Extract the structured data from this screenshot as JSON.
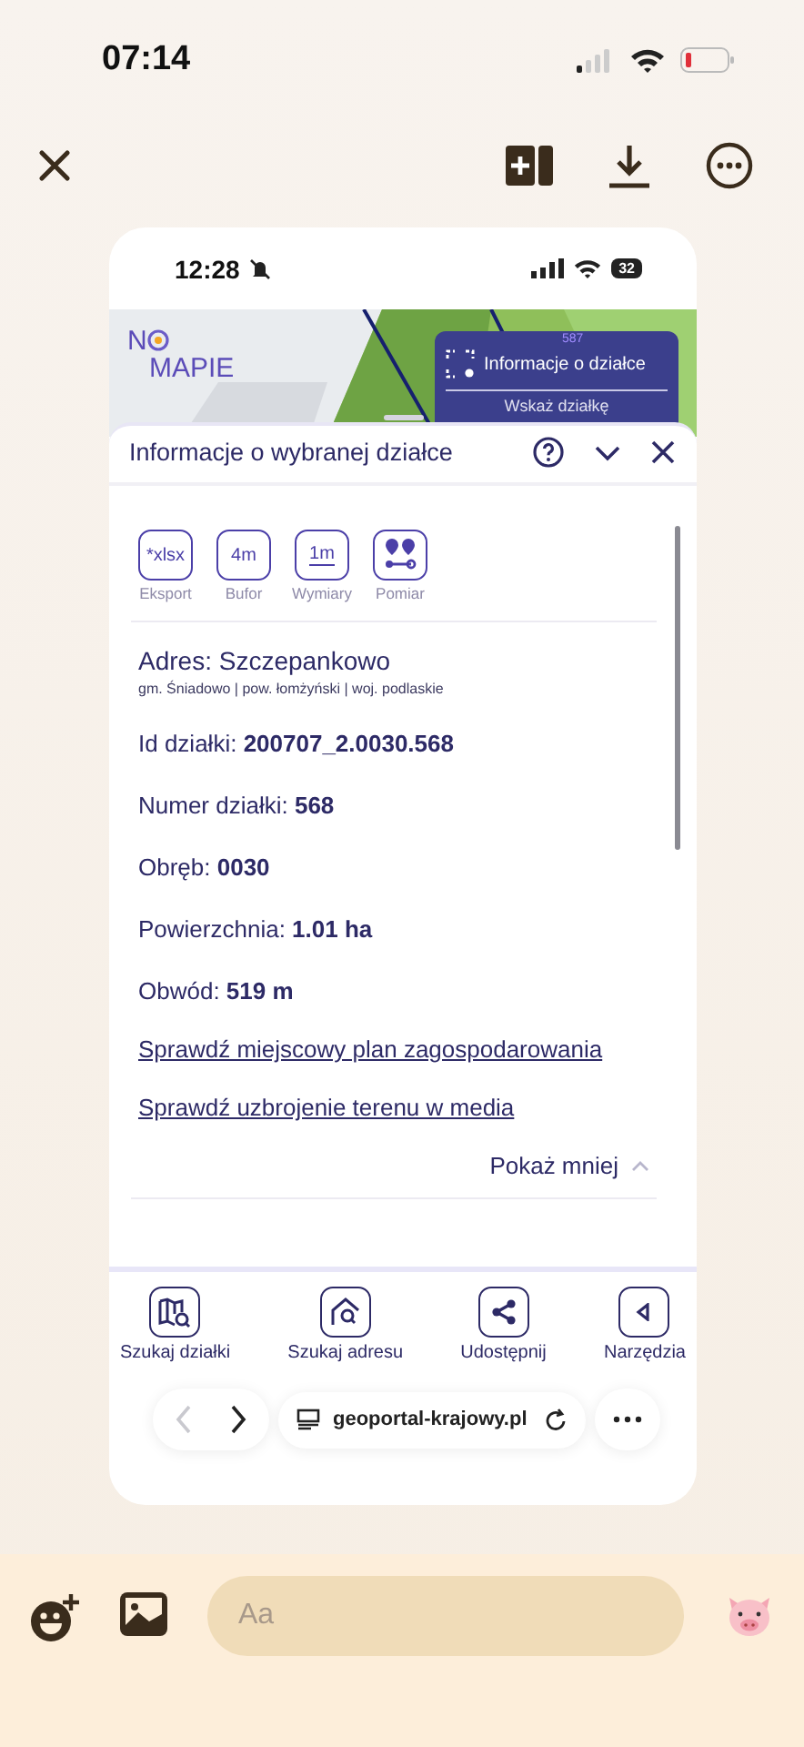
{
  "status_bar": {
    "time": "07:14"
  },
  "screenshot": {
    "status_bar": {
      "time": "12:28",
      "battery": "32"
    },
    "map": {
      "logo": [
        "N",
        "MAPIE"
      ],
      "panel": {
        "badge": "587",
        "title": "Informacje o działce",
        "action": "Wskaż działkę"
      }
    },
    "sheet": {
      "title": "Informacje o wybranej działce",
      "tools": [
        {
          "kind": "text",
          "icon_text": "*xlsx",
          "label": "Eksport"
        },
        {
          "kind": "text",
          "icon_text": "4m",
          "label": "Bufor"
        },
        {
          "kind": "ruler",
          "icon_text": "1m",
          "label": "Wymiary"
        },
        {
          "kind": "pins",
          "label": "Pomiar"
        }
      ],
      "address": {
        "title": "Adres: Szczepankowo",
        "detail": "gm. Śniadowo | pow. łomżyński | woj. podlaskie"
      },
      "fields": [
        "Id działki: **200707_2.0030.568**",
        "Numer działki: **568**",
        "Obręb: **0030**",
        "Powierzchnia: **1.01 ha**",
        "Obwód: **519 m**"
      ],
      "links": [
        "Sprawdź miejscowy plan zagospodarowania",
        "Sprawdź uzbrojenie terenu w media"
      ],
      "toggle": "Pokaż mniej"
    },
    "bottom_nav": [
      {
        "kind": "map",
        "label": "Szukaj działki"
      },
      {
        "kind": "house",
        "label": "Szukaj adresu"
      },
      {
        "kind": "share",
        "label": "Udostępnij"
      },
      {
        "kind": "tools",
        "label": "Narzędzia"
      }
    ],
    "browser": {
      "back_disabled": true,
      "forward_disabled": false,
      "url": "geoportal-krajowy.pl"
    }
  },
  "composer": {
    "placeholder": "Aa"
  }
}
